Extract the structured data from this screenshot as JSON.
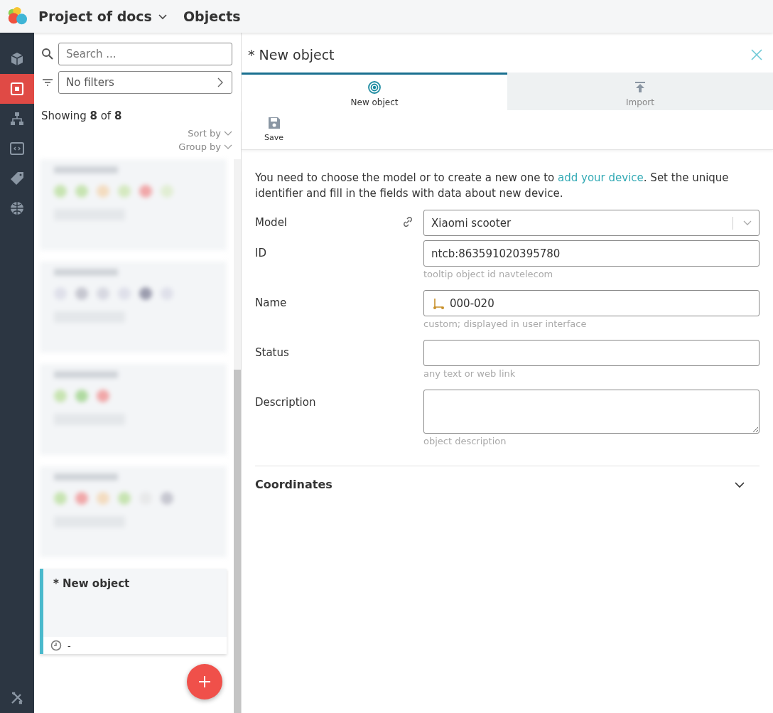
{
  "header": {
    "project": "Project of docs",
    "section": "Objects"
  },
  "nav": {
    "items": [
      {
        "kind": "cube",
        "selected": false
      },
      {
        "kind": "target",
        "selected": true
      },
      {
        "kind": "hierarchy",
        "selected": false
      },
      {
        "kind": "code",
        "selected": false
      },
      {
        "kind": "tag",
        "selected": false
      },
      {
        "kind": "globe",
        "selected": false
      }
    ],
    "bottom": {
      "kind": "tools",
      "selected": false
    }
  },
  "list": {
    "search": {
      "placeholder": "Search ..."
    },
    "filter": {
      "value": "No filters"
    },
    "showing": "Showing **8** of **8**",
    "sort": "Sort by",
    "group": "Group by",
    "cards": [
      {
        "title": "* New object",
        "time": "-",
        "selected": true
      }
    ]
  },
  "panel": {
    "title": "* New object",
    "tabs": [
      {
        "label": "New object",
        "kind": "target",
        "selected": true
      },
      {
        "label": "Import",
        "kind": "upload",
        "selected": false
      }
    ],
    "toolbar": [
      {
        "label": "Save",
        "kind": "save"
      }
    ],
    "intro": {
      "before": "You need to choose the model or to create a new one to ",
      "link": "add your device",
      "after": ". Set the unique identifier and fill in the fields with data about new device."
    },
    "fields": [
      {
        "kind": "select",
        "label": "Model",
        "value": "Xiaomi scooter",
        "linked": true
      },
      {
        "kind": "text",
        "label": "ID",
        "value": "ntcb:863591020395780",
        "hint": "tooltip object id navtelecom"
      },
      {
        "kind": "text",
        "label": "Name",
        "value": "000-020",
        "hint": "custom; displayed in user interface",
        "scooter": true
      },
      {
        "kind": "text",
        "label": "Status",
        "hint": "any text or web link"
      },
      {
        "kind": "textarea",
        "label": "Description",
        "hint": "object description"
      }
    ],
    "section": {
      "title": "Coordinates",
      "expanded": false
    }
  }
}
